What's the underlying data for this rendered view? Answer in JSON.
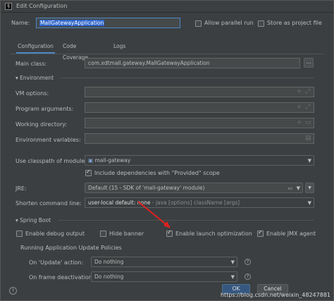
{
  "window": {
    "title": "Edit Configuration",
    "app_icon": "intellij-icon"
  },
  "header": {
    "name_label": "Name:",
    "name_value": "MallGatewayApplication",
    "allow_parallel_label": "Allow parallel run",
    "store_label": "Store as project file"
  },
  "tabs": [
    {
      "label": "Configuration",
      "active": true
    },
    {
      "label": "Code Coverage",
      "active": false
    },
    {
      "label": "Logs",
      "active": false
    }
  ],
  "config": {
    "main_class_label": "Main class:",
    "main_class_value": "com.xdtmall.gateway.MallGatewayApplication",
    "browse_label": "...",
    "environment_label": "Environment",
    "vm_options_label": "VM options:",
    "program_args_label": "Program arguments:",
    "working_dir_label": "Working directory:",
    "env_vars_label": "Environment variables:",
    "classpath_label": "Use classpath of module:",
    "classpath_value": "mall-gateway",
    "include_provided_label": "Include dependencies with \"Provided\" scope",
    "jre_label": "JRE:",
    "jre_value": "Default (15 - SDK of 'mall-gateway' module)",
    "shorten_label": "Shorten command line:",
    "shorten_value_bold": "user-local default: none",
    "shorten_value_rest": " - java [options] className [args]"
  },
  "spring_boot": {
    "section_label": "Spring Boot",
    "debug_output_label": "Enable debug output",
    "hide_banner_label": "Hide banner",
    "launch_opt_label": "Enable launch optimization",
    "jmx_label": "Enable JMX agent",
    "policies_label": "Running Application Update Policies",
    "on_update_label": "On 'Update' action:",
    "on_update_value": "Do nothing",
    "on_frame_label": "On frame deactivation:",
    "on_frame_value": "Do nothing"
  },
  "footer": {
    "ok_label": "OK",
    "cancel_label": "Cancel"
  },
  "watermark": "https://blog.csdn.net/weixin_48247881",
  "colors": {
    "accent": "#4a88c7",
    "arrow": "#e02020",
    "name_highlight": "#2f65ca"
  }
}
